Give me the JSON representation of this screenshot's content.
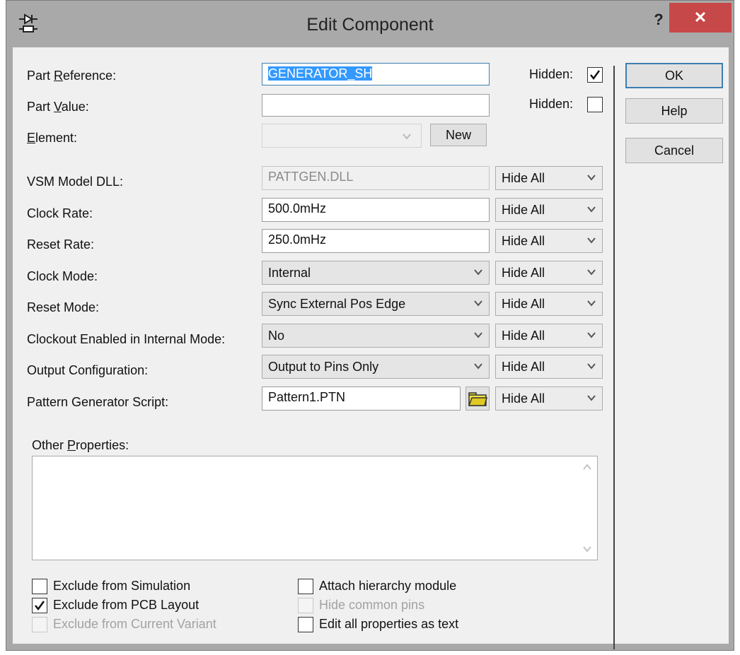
{
  "window": {
    "title": "Edit Component",
    "help_glyph": "?",
    "close_glyph": "✕",
    "icon": "component-icon"
  },
  "fields": {
    "part_reference": {
      "label_pre": "Part ",
      "label_u": "R",
      "label_post": "eference:",
      "value": "GENERATOR_SH",
      "hidden_label": "Hidden:",
      "hidden_checked": true
    },
    "part_value": {
      "label_pre": "Part ",
      "label_u": "V",
      "label_post": "alue:",
      "value": "",
      "hidden_label": "Hidden:",
      "hidden_checked": false
    },
    "element": {
      "label_u": "E",
      "label_post": "lement:",
      "value": "",
      "new_button": "New"
    }
  },
  "properties": [
    {
      "label": "VSM Model DLL:",
      "value": "PATTGEN.DLL",
      "kind": "readonly",
      "visibility": "Hide All"
    },
    {
      "label": "Clock Rate:",
      "value": "500.0mHz",
      "kind": "text",
      "visibility": "Hide All"
    },
    {
      "label": "Reset Rate:",
      "value": "250.0mHz",
      "kind": "text",
      "visibility": "Hide All"
    },
    {
      "label": "Clock Mode:",
      "value": "Internal",
      "kind": "combo",
      "visibility": "Hide All"
    },
    {
      "label": "Reset Mode:",
      "value": "Sync External Pos Edge",
      "kind": "combo",
      "visibility": "Hide All"
    },
    {
      "label": "Clockout Enabled in Internal Mode:",
      "value": "No",
      "kind": "combo",
      "visibility": "Hide All"
    },
    {
      "label": "Output Configuration:",
      "value": "Output to Pins Only",
      "kind": "combo",
      "visibility": "Hide All"
    },
    {
      "label": "Pattern Generator Script:",
      "value": "Pattern1.PTN",
      "kind": "file",
      "visibility": "Hide All"
    }
  ],
  "other_properties": {
    "label_pre": "Other ",
    "label_u": "P",
    "label_post": "roperties:",
    "value": ""
  },
  "buttons": {
    "ok": "OK",
    "help": "Help",
    "cancel": "Cancel"
  },
  "options_left": [
    {
      "label": "Exclude from Simulation",
      "checked": false,
      "enabled": true
    },
    {
      "label": "Exclude from PCB Layout",
      "checked": true,
      "enabled": true
    },
    {
      "label": "Exclude from Current Variant",
      "checked": false,
      "enabled": false
    }
  ],
  "options_right": [
    {
      "label": "Attach hierarchy module",
      "checked": false,
      "enabled": true
    },
    {
      "label": "Hide common pins",
      "checked": false,
      "enabled": false
    },
    {
      "label": "Edit all properties as text",
      "checked": false,
      "enabled": true
    }
  ]
}
